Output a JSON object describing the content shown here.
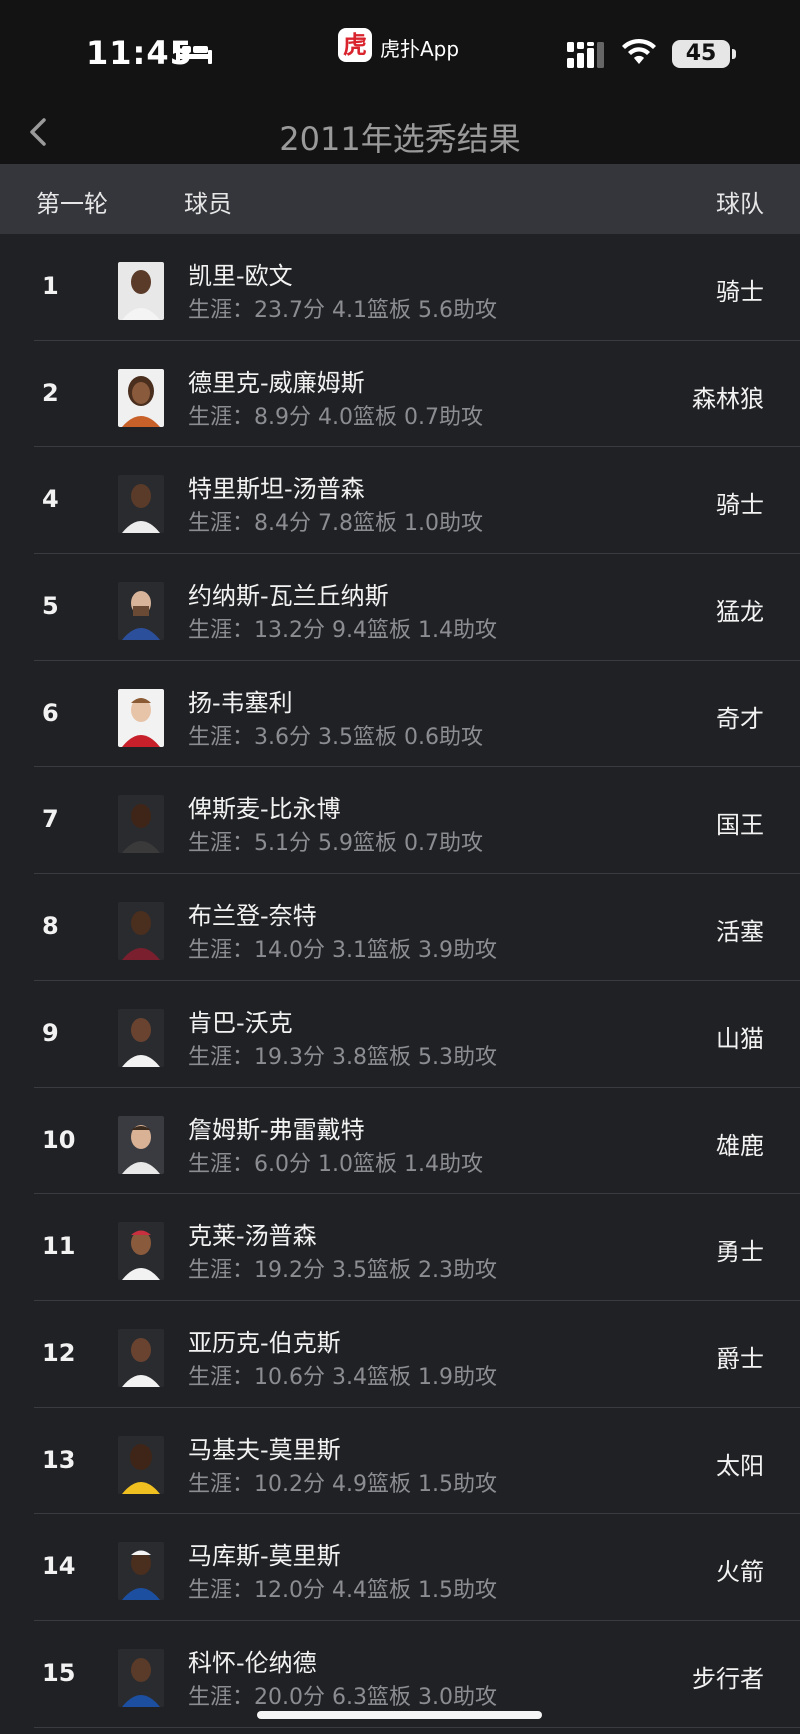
{
  "status_bar": {
    "time": "11:45",
    "app_name": "虎扑App",
    "app_logo_char": "虎",
    "battery": "45"
  },
  "nav": {
    "title": "2011年选秀结果"
  },
  "table_header": {
    "round": "第一轮",
    "player": "球员",
    "team": "球队"
  },
  "picks": [
    {
      "pick": "1",
      "name": "凯里-欧文",
      "stats": "生涯：23.7分 4.1篮板 5.6助攻",
      "team": "骑士"
    },
    {
      "pick": "2",
      "name": "德里克-威廉姆斯",
      "stats": "生涯：8.9分 4.0篮板 0.7助攻",
      "team": "森林狼"
    },
    {
      "pick": "4",
      "name": "特里斯坦-汤普森",
      "stats": "生涯：8.4分 7.8篮板 1.0助攻",
      "team": "骑士"
    },
    {
      "pick": "5",
      "name": "约纳斯-瓦兰丘纳斯",
      "stats": "生涯：13.2分 9.4篮板 1.4助攻",
      "team": "猛龙"
    },
    {
      "pick": "6",
      "name": "扬-韦塞利",
      "stats": "生涯：3.6分 3.5篮板 0.6助攻",
      "team": "奇才"
    },
    {
      "pick": "7",
      "name": "俾斯麦-比永博",
      "stats": "生涯：5.1分 5.9篮板 0.7助攻",
      "team": "国王"
    },
    {
      "pick": "8",
      "name": "布兰登-奈特",
      "stats": "生涯：14.0分 3.1篮板 3.9助攻",
      "team": "活塞"
    },
    {
      "pick": "9",
      "name": "肯巴-沃克",
      "stats": "生涯：19.3分 3.8篮板 5.3助攻",
      "team": "山猫"
    },
    {
      "pick": "10",
      "name": "詹姆斯-弗雷戴特",
      "stats": "生涯：6.0分 1.0篮板 1.4助攻",
      "team": "雄鹿"
    },
    {
      "pick": "11",
      "name": "克莱-汤普森",
      "stats": "生涯：19.2分 3.5篮板 2.3助攻",
      "team": "勇士"
    },
    {
      "pick": "12",
      "name": "亚历克-伯克斯",
      "stats": "生涯：10.6分 3.4篮板 1.9助攻",
      "team": "爵士"
    },
    {
      "pick": "13",
      "name": "马基夫-莫里斯",
      "stats": "生涯：10.2分 4.9篮板 1.5助攻",
      "team": "太阳"
    },
    {
      "pick": "14",
      "name": "马库斯-莫里斯",
      "stats": "生涯：12.0分 4.4篮板 1.5助攻",
      "team": "火箭"
    },
    {
      "pick": "15",
      "name": "科怀-伦纳德",
      "stats": "生涯：20.0分 6.3篮板 3.0助攻",
      "team": "步行者"
    }
  ],
  "colors": {
    "background": "#202124",
    "header_bg": "#34363c",
    "bar_bg": "#131313",
    "muted_text": "#8c8d92",
    "logo_red": "#d9232d"
  }
}
